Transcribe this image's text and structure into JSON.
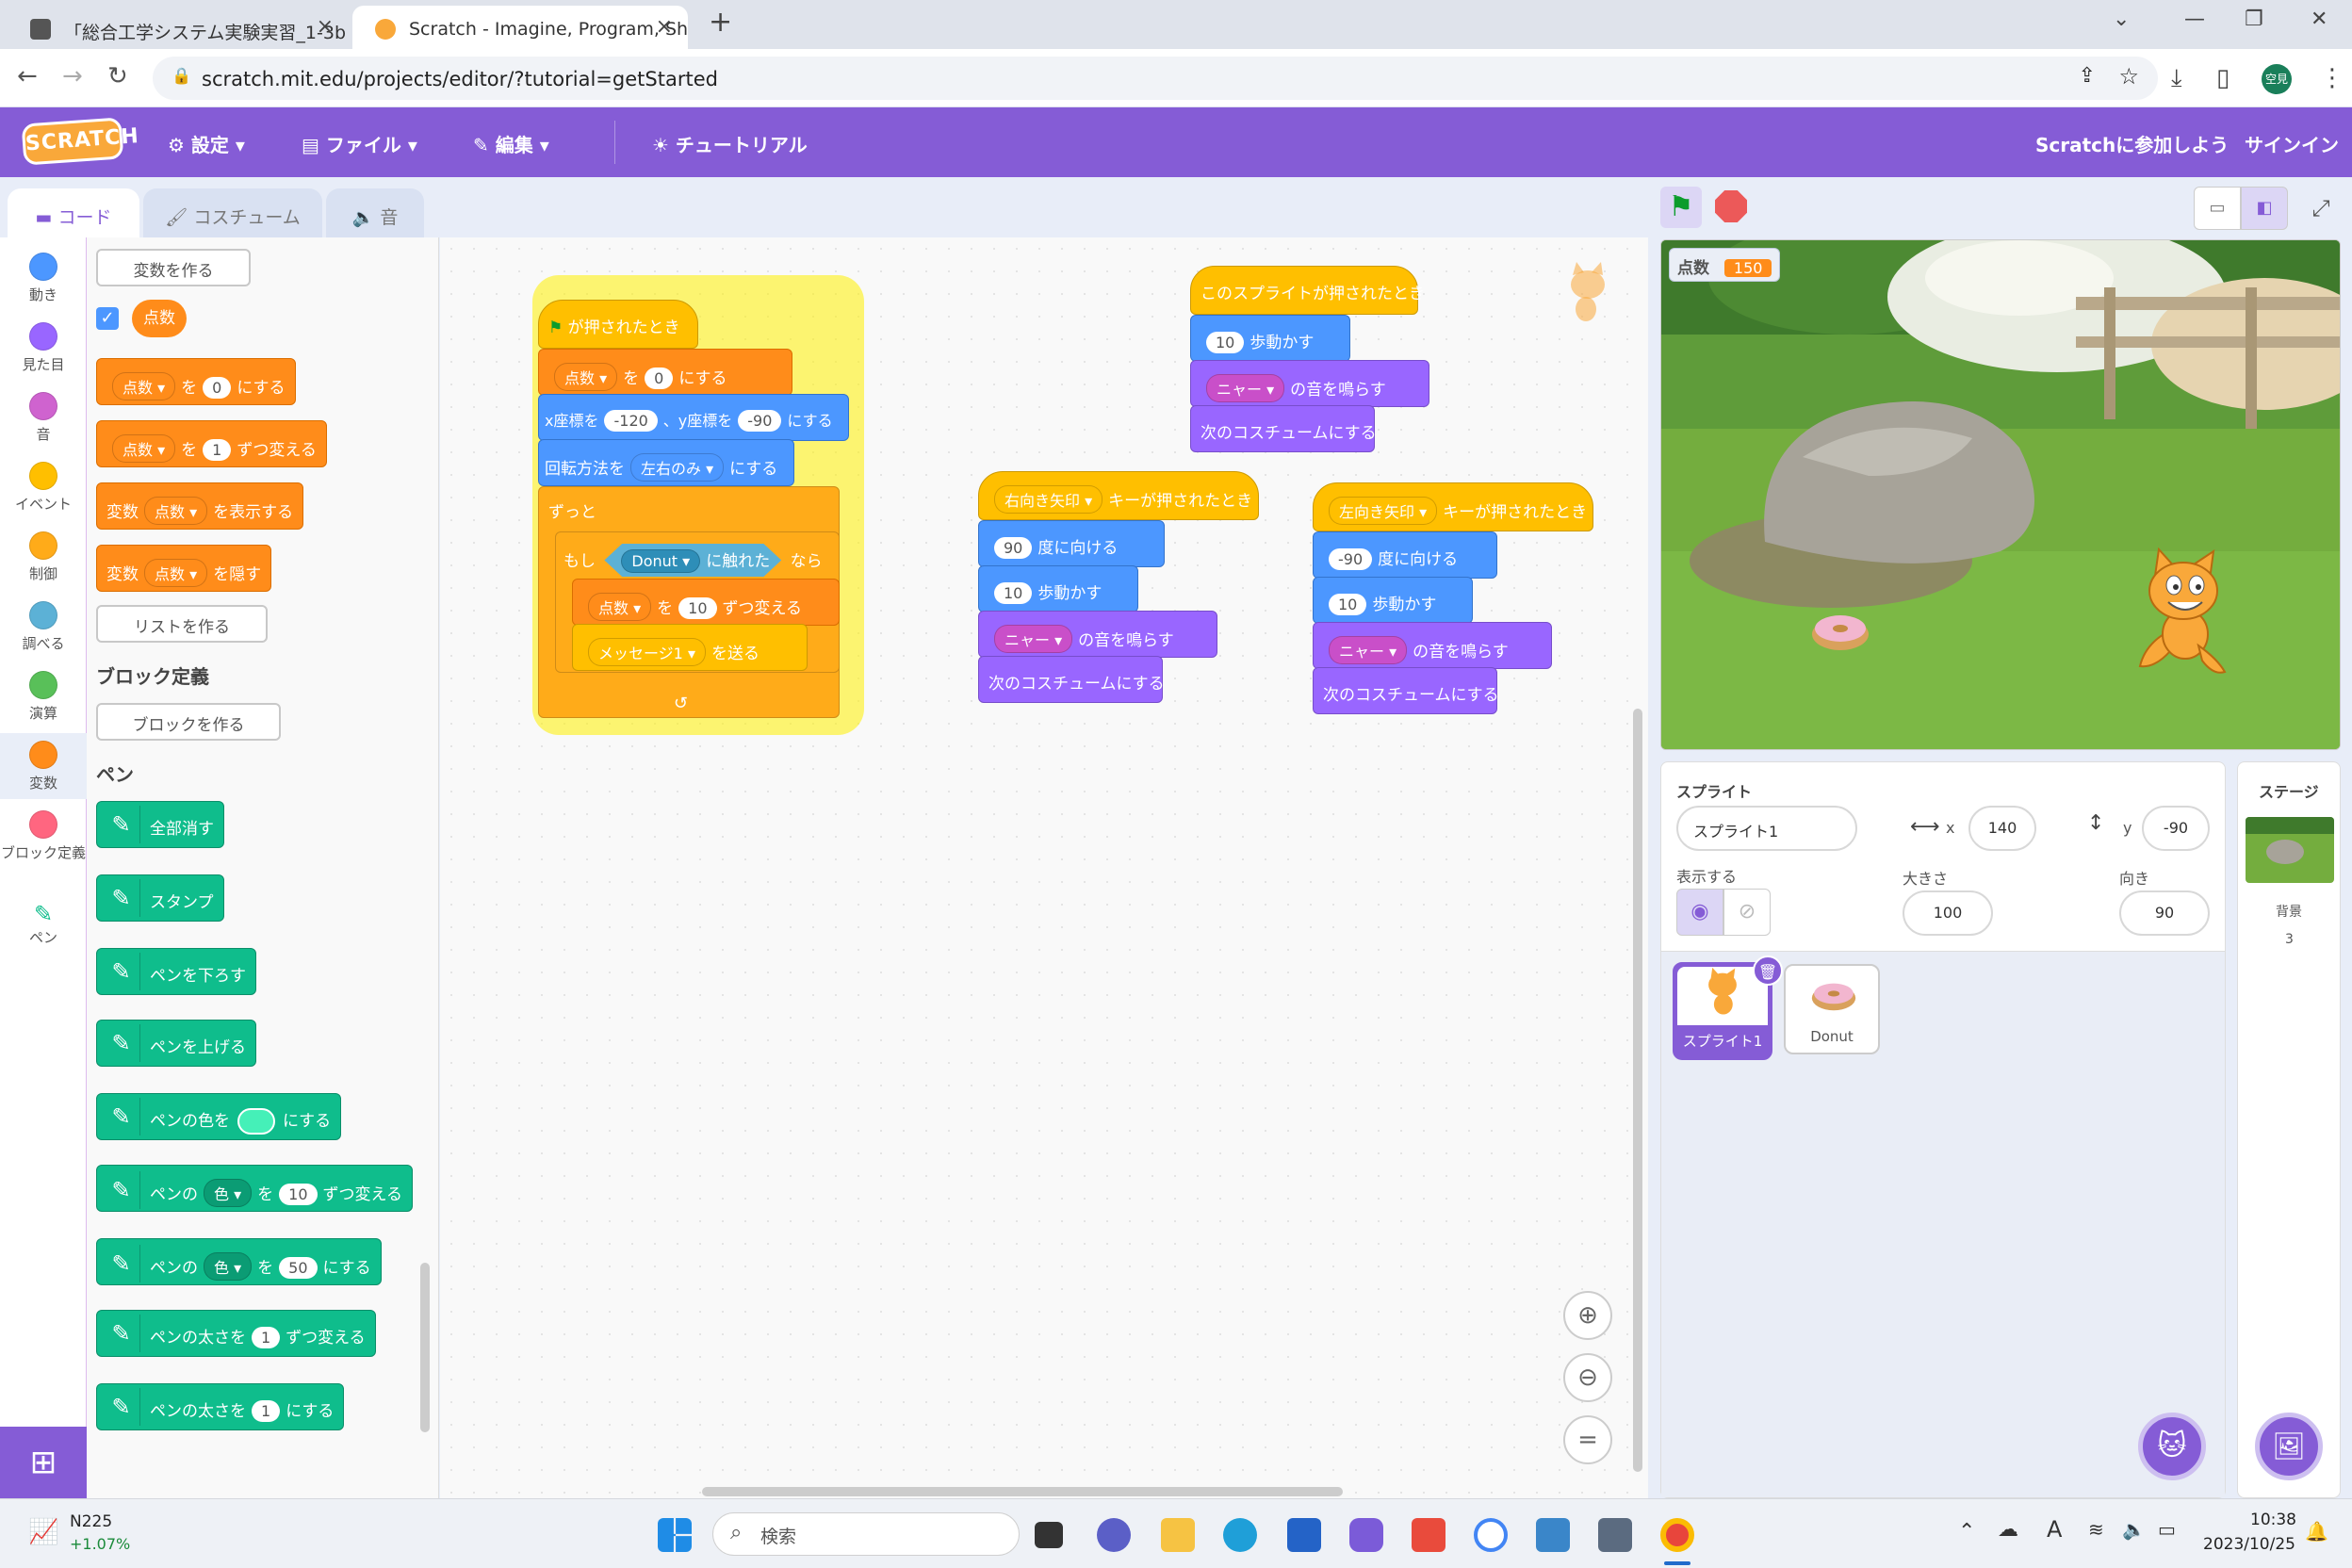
{
  "browser": {
    "tabs": [
      {
        "title": "「総合工学システム実験実習_1-3b",
        "close": "×"
      },
      {
        "title": "Scratch - Imagine, Program, Sha",
        "close": "×"
      }
    ],
    "new_tab": "+",
    "url": "scratch.mit.edu/projects/editor/?tutorial=getStarted",
    "profile": "空見"
  },
  "menu": {
    "logo": "SCRATCH",
    "settings": "設定",
    "file": "ファイル",
    "edit": "編集",
    "tutorial": "チュートリアル",
    "join": "Scratchに参加しよう",
    "signin": "サインイン"
  },
  "editor_tabs": {
    "code": "コード",
    "costume": "コスチューム",
    "sound": "音"
  },
  "categories": [
    {
      "label": "動き",
      "color": "#4c97ff"
    },
    {
      "label": "見た目",
      "color": "#9966ff"
    },
    {
      "label": "音",
      "color": "#cf63cf"
    },
    {
      "label": "イベント",
      "color": "#ffbf00"
    },
    {
      "label": "制御",
      "color": "#ffab19"
    },
    {
      "label": "調べる",
      "color": "#5cb1d6"
    },
    {
      "label": "演算",
      "color": "#59c059"
    },
    {
      "label": "変数",
      "color": "#ff8c1a"
    },
    {
      "label": "ブロック定義",
      "color": "#ff6680"
    },
    {
      "label": "ペン",
      "color": "#0fbd8c"
    }
  ],
  "palette": {
    "make_var": "変数を作る",
    "var_name": "点数",
    "set_var": {
      "var": "点数",
      "to": "を",
      "val": "0",
      "end": "にする"
    },
    "change_var": {
      "var": "点数",
      "by": "を",
      "val": "1",
      "end": "ずつ変える"
    },
    "show_var": {
      "pre": "変数",
      "var": "点数",
      "end": "を表示する"
    },
    "hide_var": {
      "pre": "変数",
      "var": "点数",
      "end": "を隠す"
    },
    "make_list": "リストを作る",
    "myblocks_header": "ブロック定義",
    "make_block": "ブロックを作る",
    "pen_header": "ペン",
    "pen_blocks": {
      "clear": "全部消す",
      "stamp": "スタンプ",
      "down": "ペンを下ろす",
      "up": "ペンを上げる",
      "color_pre": "ペンの色を",
      "color_end": "にする",
      "chg_pre": "ペンの",
      "chg_param": "色",
      "chg_mid": "を",
      "chg_val": "10",
      "chg_end": "ずつ変える",
      "set_pre": "ペンの",
      "set_param": "色",
      "set_mid": "を",
      "set_val": "50",
      "set_end": "にする",
      "size_chg_pre": "ペンの太さを",
      "size_chg_val": "1",
      "size_chg_end": "ずつ変える",
      "size_set_pre": "ペンの太さを",
      "size_set_val": "1",
      "size_set_end": "にする"
    }
  },
  "scripts": {
    "main": {
      "hat": "が押されたとき",
      "set_var": "点数",
      "set_to": "を",
      "set_val": "0",
      "set_end": "にする",
      "goto_x_label": "x座標を",
      "goto_x": "-120",
      "goto_y_label": "、y座標を",
      "goto_y": "-90",
      "goto_end": "にする",
      "rot_label": "回転方法を",
      "rot_val": "左右のみ",
      "rot_end": "にする",
      "forever": "ずっと",
      "if": "もし",
      "touch_target": "Donut",
      "touch_label": "に触れた",
      "then": "なら",
      "chg_var": "点数",
      "chg_by": "を",
      "chg_val": "10",
      "chg_end": "ずつ変える",
      "broadcast_msg": "メッセージ1",
      "broadcast_end": "を送る"
    },
    "sprite_click": {
      "hat": "このスプライトが押されたとき",
      "move_val": "10",
      "move_end": "歩動かす",
      "sound": "ニャー",
      "sound_end": "の音を鳴らす",
      "next_costume": "次のコスチュームにする"
    },
    "right_key": {
      "key": "右向き矢印",
      "hat_end": "キーが押されたとき",
      "dir_val": "90",
      "dir_end": "度に向ける",
      "move_val": "10",
      "move_end": "歩動かす",
      "sound": "ニャー",
      "sound_end": "の音を鳴らす",
      "next_costume": "次のコスチュームにする"
    },
    "left_key": {
      "key": "左向き矢印",
      "hat_end": "キーが押されたとき",
      "dir_val": "-90",
      "dir_end": "度に向ける",
      "move_val": "10",
      "move_end": "歩動かす",
      "sound": "ニャー",
      "sound_end": "の音を鳴らす",
      "next_costume": "次のコスチュームにする"
    }
  },
  "stage": {
    "monitor_label": "点数",
    "monitor_value": "150"
  },
  "sprite_info": {
    "title": "スプライト",
    "name": "スプライト1",
    "x_label": "x",
    "x": "140",
    "y_label": "y",
    "y": "-90",
    "show_label": "表示する",
    "size_label": "大きさ",
    "size": "100",
    "dir_label": "向き",
    "dir": "90"
  },
  "sprites": [
    {
      "name": "スプライト1",
      "selected": true
    },
    {
      "name": "Donut",
      "selected": false
    }
  ],
  "stage_pane": {
    "title": "ステージ",
    "backdrop_label": "背景",
    "backdrop_count": "3"
  },
  "taskbar": {
    "stock_name": "N225",
    "stock_change": "+1.07%",
    "search": "検索",
    "time": "10:38",
    "date": "2023/10/25"
  }
}
